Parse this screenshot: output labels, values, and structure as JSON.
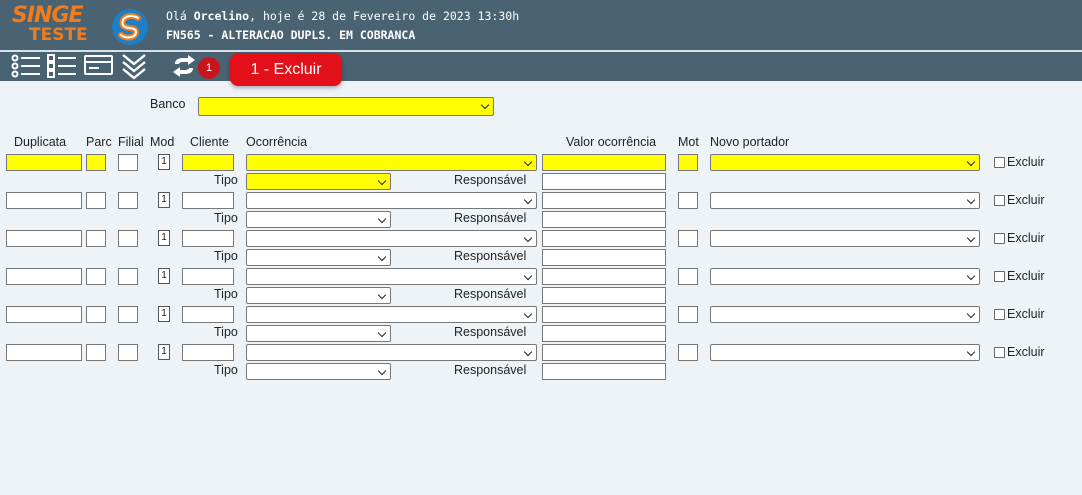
{
  "header": {
    "logo_top": "SINGE",
    "logo_bottom": "TESTE",
    "greeting_prefix": "Olá ",
    "user": "Orcelino",
    "greeting_suffix": ", hoje é 28 de Fevereiro de 2023 13:30h",
    "screen_title": "FN565 - ALTERACAO DUPLS. EM COBRANCA"
  },
  "toolbar": {
    "icons": [
      "list-icon",
      "checklist-icon",
      "card-icon",
      "double-chevron-down-icon",
      "refresh-icon"
    ],
    "badge_count": "1",
    "excluir_button": "1 - Excluir"
  },
  "form": {
    "banco_label": "Banco",
    "banco_value": ""
  },
  "columns": {
    "duplicata": "Duplicata",
    "parc": "Parc",
    "filial": "Filial",
    "mod": "Mod",
    "cliente": "Cliente",
    "ocorrencia": "Ocorrência",
    "valor_ocorrencia": "Valor ocorrência",
    "mot": "Mot",
    "novo_portador": "Novo portador"
  },
  "row_labels": {
    "tipo": "Tipo",
    "responsavel": "Responsável",
    "excluir": "Excluir"
  },
  "rows": [
    {
      "mod": "1",
      "highlighted": true
    },
    {
      "mod": "1",
      "highlighted": false
    },
    {
      "mod": "1",
      "highlighted": false
    },
    {
      "mod": "1",
      "highlighted": false
    },
    {
      "mod": "1",
      "highlighted": false
    },
    {
      "mod": "1",
      "highlighted": false
    }
  ],
  "colors": {
    "header_bg": "#4a6373",
    "logo_orange": "#f07c1e",
    "highlight_yellow": "#ffff00",
    "badge_red": "#c8141c",
    "page_bg": "#eef3f8"
  }
}
